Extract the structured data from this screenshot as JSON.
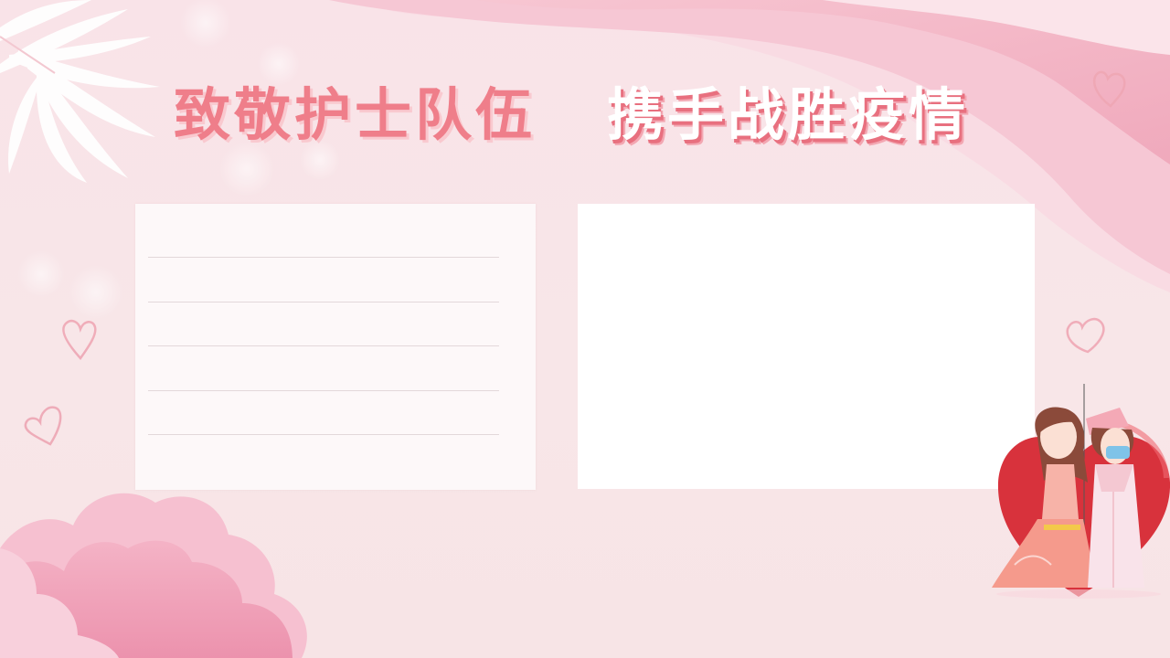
{
  "title": {
    "left": "致敬护士队伍",
    "right": "携手战胜疫情"
  },
  "colors": {
    "title_pink": "#ef7e8a",
    "wave_pink": "#f6bccb",
    "cloud_pink": "#f0a3bb",
    "heart_red": "#d8323c"
  },
  "icons": [
    "leaf-icon",
    "heart-outline-icon",
    "cloud-decoration",
    "nurse-illustration"
  ]
}
